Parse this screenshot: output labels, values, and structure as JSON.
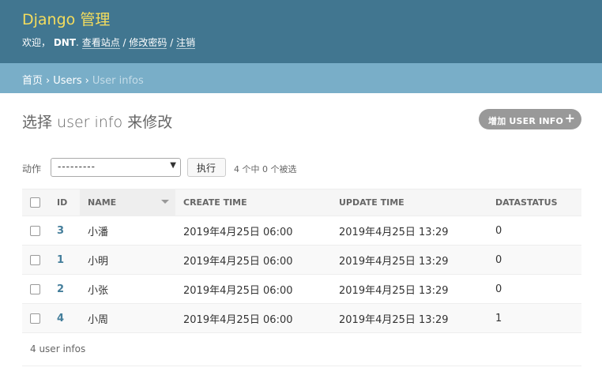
{
  "header": {
    "brand": "Django 管理",
    "welcome": "欢迎，",
    "username": "DNT",
    "view_site": "查看站点",
    "change_password": "修改密码",
    "logout": "注销",
    "sep": "/",
    "brand_color": "#f5dd5d",
    "bg_color": "#417690"
  },
  "breadcrumbs": {
    "home": "首页",
    "app": "Users",
    "current": "User infos",
    "separator": "›"
  },
  "page": {
    "title": "选择 user info 来修改",
    "add_button": "增加 USER INFO",
    "add_icon": "+"
  },
  "actions": {
    "label": "动作",
    "select_value": "---------",
    "go_button": "执行",
    "counter": "4 个中 0 个被选"
  },
  "table": {
    "columns": [
      "ID",
      "NAME",
      "CREATE TIME",
      "UPDATE TIME",
      "DATASTATUS"
    ],
    "sorted_column": "NAME",
    "rows": [
      {
        "id": "3",
        "name": "小潘",
        "create_time": "2019年4月25日 06:00",
        "update_time": "2019年4月25日 13:29",
        "datastatus": "0"
      },
      {
        "id": "1",
        "name": "小明",
        "create_time": "2019年4月25日 06:00",
        "update_time": "2019年4月25日 13:29",
        "datastatus": "0"
      },
      {
        "id": "2",
        "name": "小张",
        "create_time": "2019年4月25日 06:00",
        "update_time": "2019年4月25日 13:29",
        "datastatus": "0"
      },
      {
        "id": "4",
        "name": "小周",
        "create_time": "2019年4月25日 06:00",
        "update_time": "2019年4月25日 13:29",
        "datastatus": "1"
      }
    ]
  },
  "paginator": {
    "text": "4 user infos"
  }
}
